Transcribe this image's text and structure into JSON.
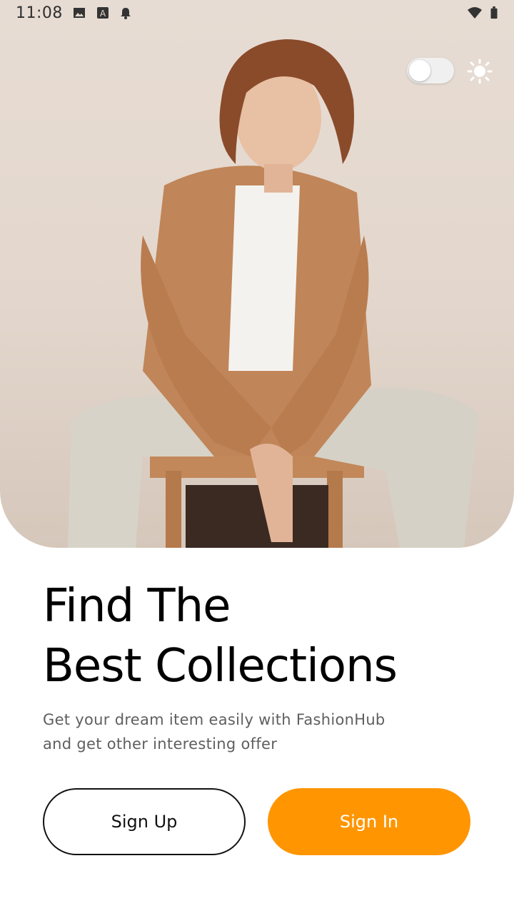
{
  "status_bar": {
    "time": "11:08",
    "icons": [
      "image-icon",
      "a-icon",
      "bell-icon",
      "wifi-icon",
      "battery-icon"
    ]
  },
  "hero": {
    "image_desc_icon": "person-photo",
    "theme_toggle_state": "off",
    "theme_icon": "sun-icon"
  },
  "headline": {
    "line1": "Find The",
    "line2": "Best Collections"
  },
  "subtitle": {
    "line1": "Get your dream item easily with FashionHub",
    "line2": "and get other interesting offer"
  },
  "buttons": {
    "signup": "Sign Up",
    "signin": "Sign In"
  },
  "colors": {
    "accent": "#ff9500",
    "text": "#000000",
    "muted": "#5f5f5f"
  }
}
